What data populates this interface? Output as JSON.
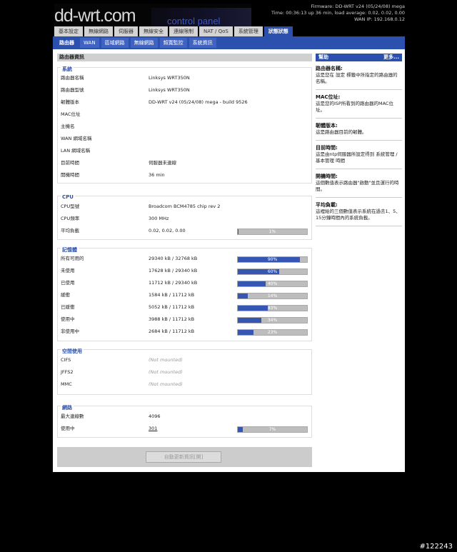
{
  "header": {
    "logo_left": "dd-wrt.com",
    "logo_right": "control panel",
    "firmware": "Firmware: DD-WRT v24 (05/24/08) mega",
    "time": "Time: 00:36:13 up 36 min, load average: 0.02, 0.02, 0.00",
    "wan_ip": "WAN IP: 192.168.0.12"
  },
  "tabs": [
    "基本設定",
    "無線網路",
    "伺服器",
    "無線安全",
    "連線限制",
    "NAT / QoS",
    "系統管理",
    "狀態狀態"
  ],
  "subtabs": [
    "路由器",
    "WAN",
    "區域網路",
    "無線網路",
    "頻寬監控",
    "系統資訊"
  ],
  "main": {
    "title": "路由器資訊",
    "system": {
      "title": "系統",
      "rows": [
        {
          "label": "路由器名稱",
          "value": "Linksys WRT350N"
        },
        {
          "label": "路由器型號",
          "value": "Linksys WRT350N"
        },
        {
          "label": "韌體版本",
          "value": "DD-WRT v24 (05/24/08) mega - build 9526"
        },
        {
          "label": "MAC位址",
          "value": ""
        },
        {
          "label": "主機名",
          "value": ""
        },
        {
          "label": "WAN 網域名稱",
          "value": ""
        },
        {
          "label": "LAN 網域名稱",
          "value": ""
        },
        {
          "label": "目前時間",
          "value": "伺服器未連線"
        },
        {
          "label": "開機時間",
          "value": "36 min"
        }
      ]
    },
    "cpu": {
      "title": "CPU",
      "rows": [
        {
          "label": "CPU型號",
          "value": "Broadcom BCM4785 chip rev 2"
        },
        {
          "label": "CPU頻率",
          "value": "300 MHz"
        },
        {
          "label": "平均負載",
          "value": "0.02, 0.02, 0.00",
          "pct_label": "1%",
          "pct": 0.01
        }
      ]
    },
    "memory": {
      "title": "記憶體",
      "rows": [
        {
          "label": "所有可用的",
          "value": "29340 kB / 32768 kB",
          "pct_label": "90%",
          "pct": 0.9
        },
        {
          "label": "未使用",
          "value": "17628 kB / 29340 kB",
          "pct_label": "60%",
          "pct": 0.6
        },
        {
          "label": "已使用",
          "value": "11712 kB / 29340 kB",
          "pct_label": "40%",
          "pct": 0.4
        },
        {
          "label": "緩衝",
          "value": "1584 kB / 11712 kB",
          "pct_label": "14%",
          "pct": 0.14
        },
        {
          "label": "已緩衝",
          "value": "5052 kB / 11712 kB",
          "pct_label": "43%",
          "pct": 0.43
        },
        {
          "label": "使用中",
          "value": "3988 kB / 11712 kB",
          "pct_label": "34%",
          "pct": 0.34
        },
        {
          "label": "非使用中",
          "value": "2684 kB / 11712 kB",
          "pct_label": "23%",
          "pct": 0.23
        }
      ]
    },
    "space": {
      "title": "空間使用",
      "rows": [
        {
          "label": "CIFS",
          "value": "(Not mounted)"
        },
        {
          "label": "JFFS2",
          "value": "(Not mounted)"
        },
        {
          "label": "MMC",
          "value": "(Not mounted)"
        }
      ]
    },
    "network": {
      "title": "網路",
      "rows": [
        {
          "label": "最大連線數",
          "value": "4096"
        },
        {
          "label": "使用中",
          "value": "301",
          "pct_label": "7%",
          "pct": 0.07
        }
      ]
    },
    "refresh_button": "自動更新資訊[開]"
  },
  "help": {
    "title": "幫助",
    "more": "更多...",
    "items": [
      {
        "title": "路由器名稱:",
        "desc": "這是您在 設定 標籤中所指定的路由器的名稱。"
      },
      {
        "title": "MAC位址:",
        "desc": "這是您的ISP所看到的路由器的MAC位址。"
      },
      {
        "title": "韌體版本:",
        "desc": "這是路由器目前的韌體。"
      },
      {
        "title": "目前時間:",
        "desc": "這是由ntp伺服器所設定得到 系統管理 / 基本管理 時間"
      },
      {
        "title": "開機時間:",
        "desc": "這個數值表示路由器\"啟動\"並且運行的時間。"
      },
      {
        "title": "平均負載:",
        "desc": "這裡給的三個數值表示系統在過去1、5、15分鐘時間內的系統負載。"
      }
    ]
  },
  "watermark": "#122243"
}
